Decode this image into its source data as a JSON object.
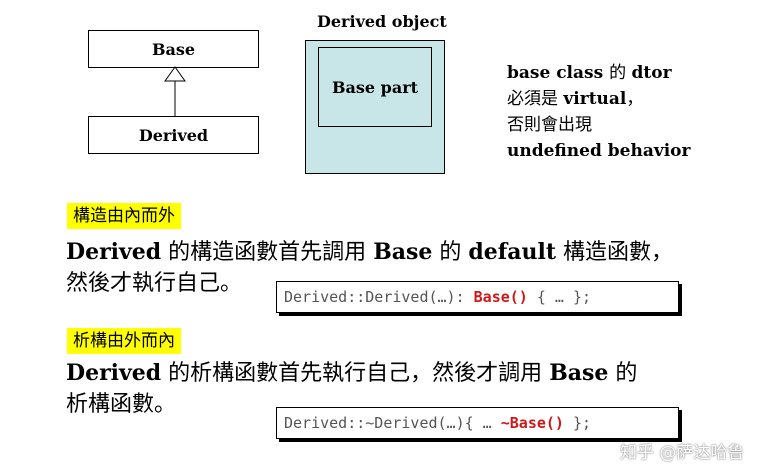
{
  "uml": {
    "base_label": "Base",
    "derived_label": "Derived"
  },
  "object": {
    "title": "Derived object",
    "inner_label": "Base part",
    "fill_color": "#c8e5e8"
  },
  "note": {
    "line1_a": "base class ",
    "line1_b": "的 ",
    "line1_c": "dtor",
    "line2_a": "必須是 ",
    "line2_b": "virtual",
    "line2_c": "，",
    "line3": "否則會出現",
    "line4": "undefined behavior"
  },
  "section1": {
    "tag": "構造由內而外",
    "line1_a": "Derived",
    "line1_b": " 的構造函數首先調用 ",
    "line1_c": "Base",
    "line1_d": " 的 ",
    "line1_e": "default",
    "line1_f": " 構造函數，",
    "line2": "然後才執行自己。",
    "code_pre": "Derived::Derived(…): ",
    "code_red": "Base()",
    "code_post": " { … };"
  },
  "section2": {
    "tag": "析構由外而內",
    "line1_a": "Derived",
    "line1_b": " 的析構函數首先執行自己，然後才調用 ",
    "line1_c": "Base",
    "line1_d": " 的",
    "line2": "析構函數。",
    "code_pre": "Derived::~Derived(…){ … ",
    "code_red": "~Base()",
    "code_post": " };"
  },
  "watermark": {
    "text": "知乎 @萨达哈鲁"
  },
  "colors": {
    "highlight": "#ffff00",
    "code_red": "#d01818"
  }
}
